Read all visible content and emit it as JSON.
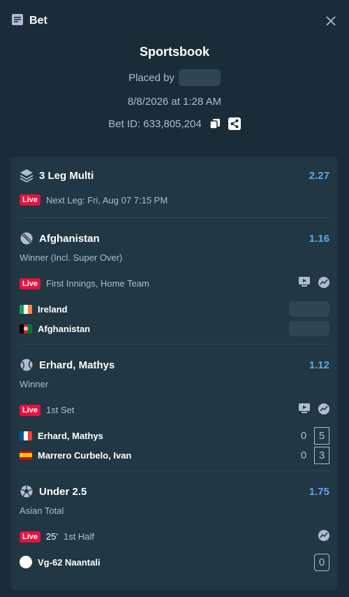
{
  "header": {
    "title": "Bet"
  },
  "info": {
    "book": "Sportsbook",
    "placed_by": "Placed by",
    "date": "8/8/2026 at 1:28 AM",
    "bet_id": "Bet ID: 633,805,204"
  },
  "multi": {
    "title": "3 Leg Multi",
    "odds": "2.27",
    "live": "Live",
    "next_leg": "Next Leg: Fri, Aug 07 7:15 PM"
  },
  "legs": [
    {
      "title": "Afghanistan",
      "odds": "1.16",
      "market": "Winner (Incl. Super Over)",
      "live": "Live",
      "status": "First Innings, Home Team",
      "teams": [
        "Ireland",
        "Afghanistan"
      ]
    },
    {
      "title": "Erhard, Mathys",
      "odds": "1.12",
      "market": "Winner",
      "live": "Live",
      "status": "1st Set",
      "teams": [
        "Erhard, Mathys",
        "Marrero Curbelo, Ivan"
      ],
      "scores": [
        [
          "0",
          "5"
        ],
        [
          "0",
          "3"
        ]
      ]
    },
    {
      "title": "Under 2.5",
      "odds": "1.75",
      "market": "Asian Total",
      "live": "Live",
      "minute": "25'",
      "status": "1st Half",
      "teams": [
        "Vg-62 Naantali"
      ],
      "scores": [
        "0"
      ]
    }
  ],
  "colors": {
    "accent": "#58a9ee",
    "live": "#e9113c",
    "bg": "#1a2c38",
    "card": "#213743"
  }
}
